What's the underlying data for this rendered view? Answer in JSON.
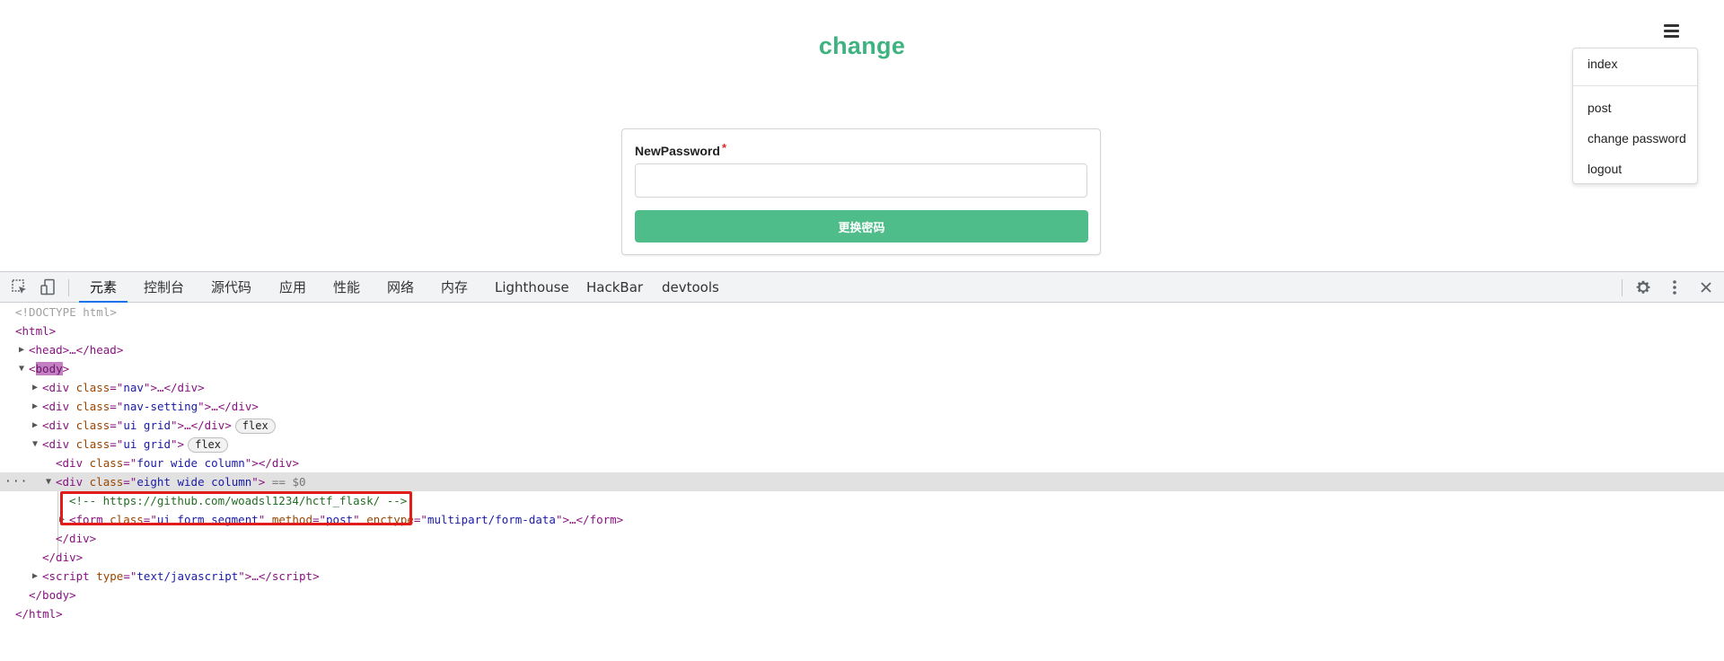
{
  "page": {
    "title": "change",
    "menu": {
      "icon": "hamburger-menu-icon",
      "items": [
        "index",
        "post",
        "change password",
        "logout"
      ]
    },
    "form": {
      "label": "NewPassword",
      "required_mark": "*",
      "input_value": "",
      "submit_label": "更换密码"
    },
    "colors": {
      "title": "#3eb37f",
      "button": "#4ebd8a",
      "required": "#db2828"
    }
  },
  "devtools": {
    "toolbar_icons": {
      "inspect": "inspect-element-icon",
      "device": "device-toolbar-icon",
      "settings": "gear-icon",
      "more": "kebab-menu-icon",
      "close": "close-icon"
    },
    "tabs": [
      "元素",
      "控制台",
      "源代码",
      "应用",
      "性能",
      "网络",
      "内存",
      "Lighthouse",
      "HackBar",
      "devtools"
    ],
    "active_tab": "元素",
    "dom": {
      "doctype": "<!DOCTYPE html>",
      "html_open": "<html>",
      "head": "<head>…</head>",
      "body_tag": "body",
      "div_nav_attr": "nav",
      "div_nav_setting_attr": "nav-setting",
      "div_ui_grid_attr": "ui grid",
      "flex_badge": "flex",
      "div_four_wide_attr": "four wide column",
      "div_eight_wide_attr": "eight wide column",
      "selected_marker": "== $0",
      "comment": "<!-- https://github.com/woadsl1234/hctf_flask/ -->",
      "form_class": "ui form segment",
      "form_method": "post",
      "form_enctype": "multipart/form-data",
      "script_type": "text/javascript",
      "body_close": "</body>",
      "html_close": "</html>"
    }
  }
}
